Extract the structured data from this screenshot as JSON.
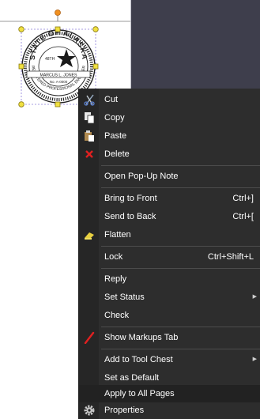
{
  "stamp": {
    "arc_top": "STATE OF ALASKA",
    "number_left": "48TH",
    "name": "MARCUS L. JONES",
    "license": "No. A-0000",
    "arc_bottom": "REGISTERED PROFESSIONAL ENGINEER"
  },
  "colors": {
    "menu_bg": "#2d2d2d",
    "menu_text": "#ffffff",
    "canvas_bg": "#3e3e4c",
    "highlight_bg": "#222222",
    "handle_yellow": "#f0e040",
    "rotate_handle_orange": "#f09020"
  },
  "menu": {
    "cut": "Cut",
    "copy": "Copy",
    "paste": "Paste",
    "delete": "Delete",
    "open_popup": "Open Pop-Up Note",
    "bring_front": "Bring to Front",
    "bring_front_sc": "Ctrl+]",
    "send_back": "Send to Back",
    "send_back_sc": "Ctrl+[",
    "flatten": "Flatten",
    "lock": "Lock",
    "lock_sc": "Ctrl+Shift+L",
    "reply": "Reply",
    "set_status": "Set Status",
    "check": "Check",
    "show_markups": "Show Markups Tab",
    "add_tool_chest": "Add to Tool Chest",
    "set_default": "Set as Default",
    "apply_all": "Apply to All Pages",
    "properties": "Properties"
  },
  "icons": [
    "scissors-icon",
    "copy-icon",
    "paste-icon",
    "delete-x-icon",
    "flatten-icon",
    "pen-icon",
    "gear-icon"
  ]
}
